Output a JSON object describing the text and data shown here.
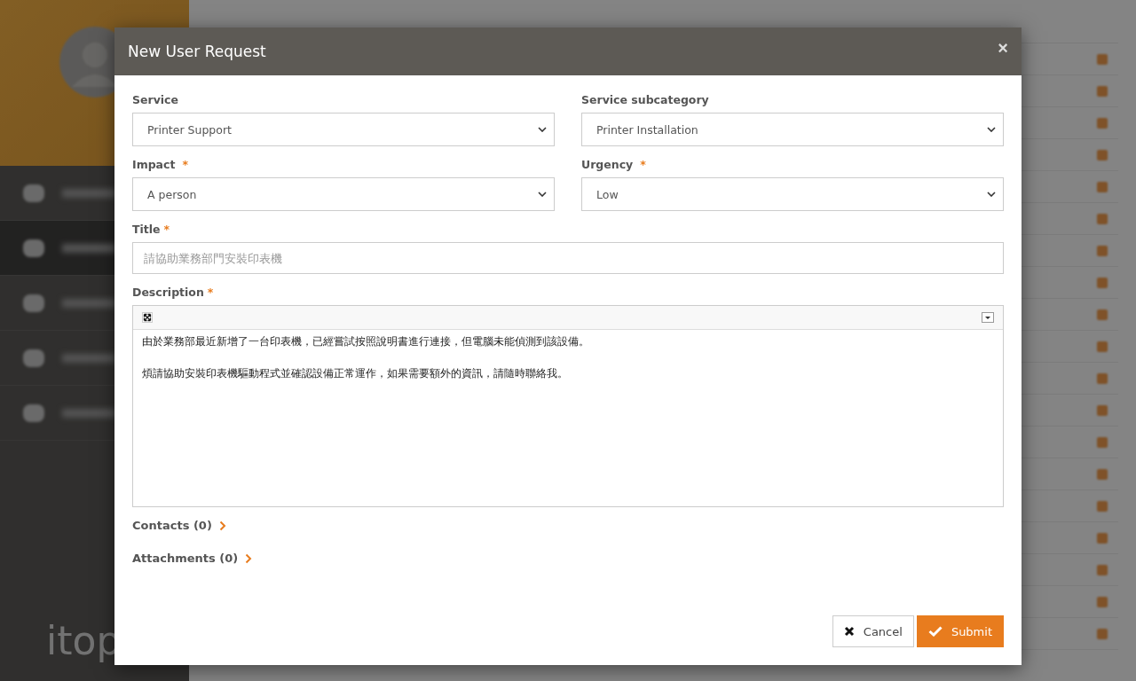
{
  "background": {
    "logo": "itop",
    "sidebar_items": [
      {
        "selected": false
      },
      {
        "selected": true
      },
      {
        "selected": false
      },
      {
        "selected": false
      },
      {
        "selected": false
      }
    ]
  },
  "dialog": {
    "title": "New User Request",
    "close": "×",
    "fields": [
      {
        "kind": "select",
        "label": "Service",
        "value": "Printer Support"
      },
      {
        "kind": "select",
        "label": "Service subcategory",
        "value": "Printer Installation"
      },
      {
        "kind": "select",
        "label": "Impact",
        "required_mark": "*",
        "value": "A person"
      },
      {
        "kind": "select",
        "label": "Urgency",
        "required_mark": "*",
        "value": "Low"
      },
      {
        "kind": "text",
        "label": "Title",
        "required_mark": "*",
        "placeholder": "請協助業務部門安裝印表機"
      },
      {
        "kind": "editor",
        "label": "Description",
        "required_mark": "*",
        "paragraphs": [
          "由於業務部最近新增了一台印表機，已經嘗試按照說明書進行連接，但電腦未能偵測到該設備。",
          "煩請協助安裝印表機驅動程式並確認設備正常運作，如果需要額外的資訊，請隨時聯絡我。"
        ]
      }
    ],
    "sections": [
      {
        "label": "Contacts (0)",
        "expanded": false
      },
      {
        "label": "Attachments (0)",
        "expanded": false
      }
    ],
    "buttons": [
      {
        "kind": "cancel",
        "label": "Cancel"
      },
      {
        "kind": "submit",
        "label": "Submit"
      }
    ]
  }
}
